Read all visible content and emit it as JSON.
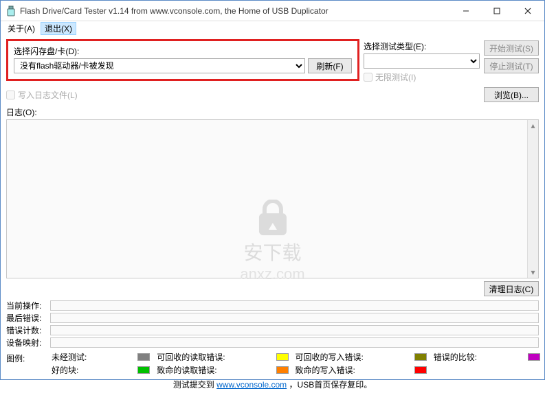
{
  "window": {
    "title": "Flash Drive/Card Tester v1.14 from www.vconsole.com, the Home of USB Duplicator"
  },
  "menu": {
    "about": "关于(A)",
    "exit": "退出(X)"
  },
  "selectFlash": {
    "label": "选择闪存盘/卡(D):",
    "value": "没有flash驱动器/卡被发现",
    "refresh": "刷新(F)"
  },
  "testType": {
    "label": "选择测试类型(E):",
    "unlimited": "无限测试(I)"
  },
  "buttons": {
    "start": "开始测试(S)",
    "stop": "停止测试(T)",
    "browse": "浏览(B)...",
    "clear": "清理日志(C)"
  },
  "writeLog": "写入日志文件(L)",
  "logLabel": "日志(O):",
  "status": {
    "current": "当前操作:",
    "lastError": "最后错误:",
    "errorCount": "错误计数:",
    "deviceMap": "设备映射:"
  },
  "legend": {
    "label": "图例:",
    "untested": "未经测试:",
    "goodBlock": "好的块:",
    "recReadErr": "可回收的读取错误:",
    "fatalReadErr": "致命的读取错误:",
    "recWriteErr": "可回收的写入错误:",
    "fatalWriteErr": "致命的写入错误:",
    "errCompare": "错误的比较:",
    "colors": {
      "untested": "#808080",
      "goodBlock": "#00c000",
      "recReadErr": "#ffff00",
      "fatalReadErr": "#ff7f00",
      "recWriteErr": "#808000",
      "fatalWriteErr": "#ff0000",
      "errCompare": "#c000c0"
    }
  },
  "footer": {
    "pre": "测试提交到 ",
    "link": "www.vconsole.com",
    "post": " ，USB首页保存复印。"
  },
  "watermark": {
    "cn": "安下载",
    "en": "anxz.com"
  }
}
